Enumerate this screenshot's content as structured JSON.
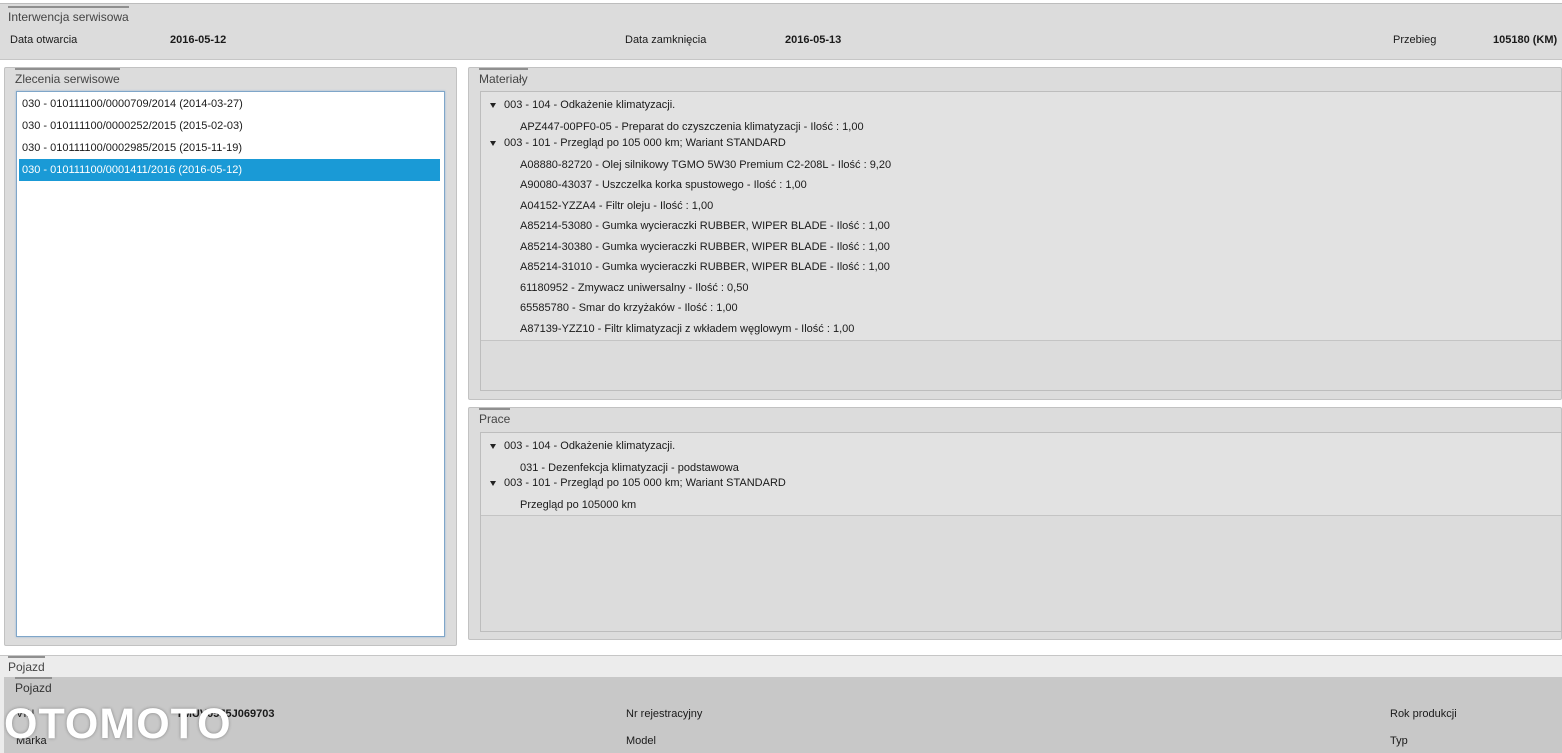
{
  "service": {
    "title": "Interwencja serwisowa",
    "open_date_label": "Data otwarcia",
    "open_date": "2016-05-12",
    "close_date_label": "Data zamknięcia",
    "close_date": "2016-05-13",
    "mileage_label": "Przebieg",
    "mileage": "105180 (KM)"
  },
  "orders": {
    "title": "Zlecenia serwisowe",
    "items": [
      {
        "label": "030 - 010111100/0000709/2014 (2014-03-27)"
      },
      {
        "label": "030 - 010111100/0000252/2015 (2015-02-03)"
      },
      {
        "label": "030 - 010111100/0002985/2015 (2015-11-19)"
      },
      {
        "label": "030 - 010111100/0001411/2016 (2016-05-12)",
        "selected": true
      }
    ]
  },
  "materials": {
    "title": "Materiały",
    "groups": [
      {
        "label": "003 - 104 - Odkażenie klimatyzacji.",
        "items": [
          "APZ447-00PF0-05 - Preparat do czyszczenia klimatyzacji - Ilość : 1,00"
        ]
      },
      {
        "label": "003 - 101 - Przegląd po 105 000 km; Wariant STANDARD",
        "items": [
          "A08880-82720 - Olej silnikowy TGMO 5W30 Premium C2-208L - Ilość : 9,20",
          "A90080-43037 - Uszczelka korka spustowego - Ilość : 1,00",
          "A04152-YZZA4 - Filtr oleju - Ilość : 1,00",
          "A85214-53080 - Gumka wycieraczki RUBBER, WIPER BLADE - Ilość : 1,00",
          "A85214-30380 - Gumka wycieraczki RUBBER, WIPER BLADE - Ilość : 1,00",
          "A85214-31010 - Gumka wycieraczki RUBBER, WIPER BLADE - Ilość : 1,00",
          "61180952 - Zmywacz uniwersalny - Ilość : 0,50",
          "65585780 - Smar do krzyżaków - Ilość : 1,00",
          "A87139-YZZ10 - Filtr klimatyzacji z wkładem węglowym - Ilość : 1,00"
        ]
      }
    ]
  },
  "works": {
    "title": "Prace",
    "groups": [
      {
        "label": "003 - 104 - Odkażenie klimatyzacji.",
        "items": [
          "031 - Dezenfekcja klimatyzacji - podstawowa"
        ]
      },
      {
        "label": "003 - 101 - Przegląd po 105 000 km; Wariant STANDARD",
        "items": [
          "Przegląd po 105000 km"
        ]
      }
    ]
  },
  "vehicle": {
    "outer_title": "Pojazd",
    "inner_title": "Pojazd",
    "vin_label": "VIN",
    "vin": "TMUV05J5J069703",
    "make_label": "Marka",
    "reg_label": "Nr rejestracyjny",
    "model_label": "Model",
    "year_label": "Rok produkcji",
    "type_label": "Typ"
  },
  "watermark": "OTOMOTO"
}
